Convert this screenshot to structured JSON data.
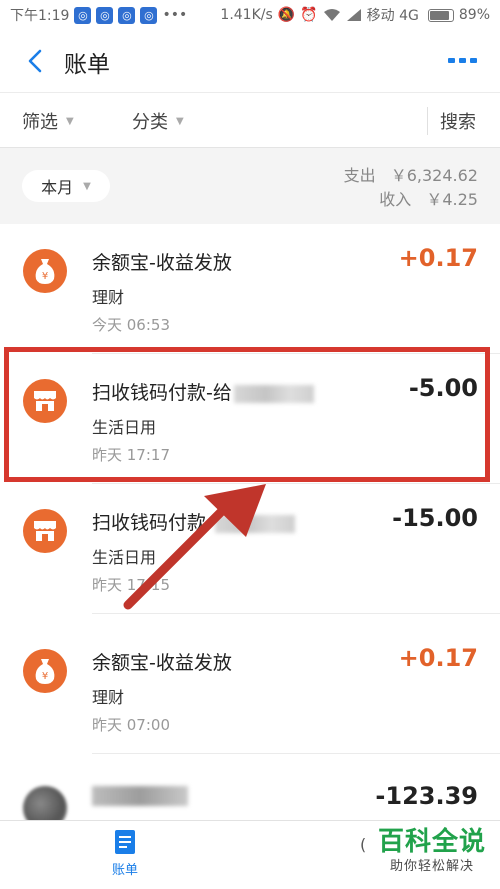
{
  "status_bar": {
    "time": "下午1:19",
    "notification_count": 4,
    "network_speed": "1.41K/s",
    "carrier": "移动 4G",
    "battery": "89%"
  },
  "header": {
    "title": "账单",
    "more_label": "更多"
  },
  "filters": {
    "filter_label": "筛选",
    "category_label": "分类",
    "search_label": "搜索"
  },
  "summary": {
    "period": "本月",
    "expense_label": "支出",
    "expense_value": "￥6,324.62",
    "income_label": "收入",
    "income_value": "￥4.25"
  },
  "transactions": [
    {
      "title": "余额宝-收益发放",
      "category": "理财",
      "time": "今天  06:53",
      "amount": "+0.17",
      "type": "income",
      "icon": "money-bag-icon"
    },
    {
      "title": "扫收钱码付款-给",
      "category": "生活日用",
      "time": "昨天  17:17",
      "amount": "-5.00",
      "type": "expense",
      "icon": "shop-icon",
      "highlighted": true
    },
    {
      "title": "扫收钱码付款-",
      "category": "生活日用",
      "time": "昨天  17:15",
      "amount": "-15.00",
      "type": "expense",
      "icon": "shop-icon"
    },
    {
      "title": "余额宝-收益发放",
      "category": "理财",
      "time": "昨天  07:00",
      "amount": "+0.17",
      "type": "income",
      "icon": "money-bag-icon"
    },
    {
      "title": "",
      "category": "",
      "time": "",
      "amount": "-123.39",
      "type": "expense",
      "icon": "avatar"
    }
  ],
  "tabbar": {
    "bill_label": "账单"
  },
  "watermark": {
    "main": "百科全说",
    "sub": "助你轻松解决"
  },
  "colors": {
    "accent_blue": "#1a7ee8",
    "income_orange": "#e2622a",
    "icon_orange": "#e96b30",
    "highlight_red": "#d6382e",
    "watermark_green": "#21a24b"
  }
}
